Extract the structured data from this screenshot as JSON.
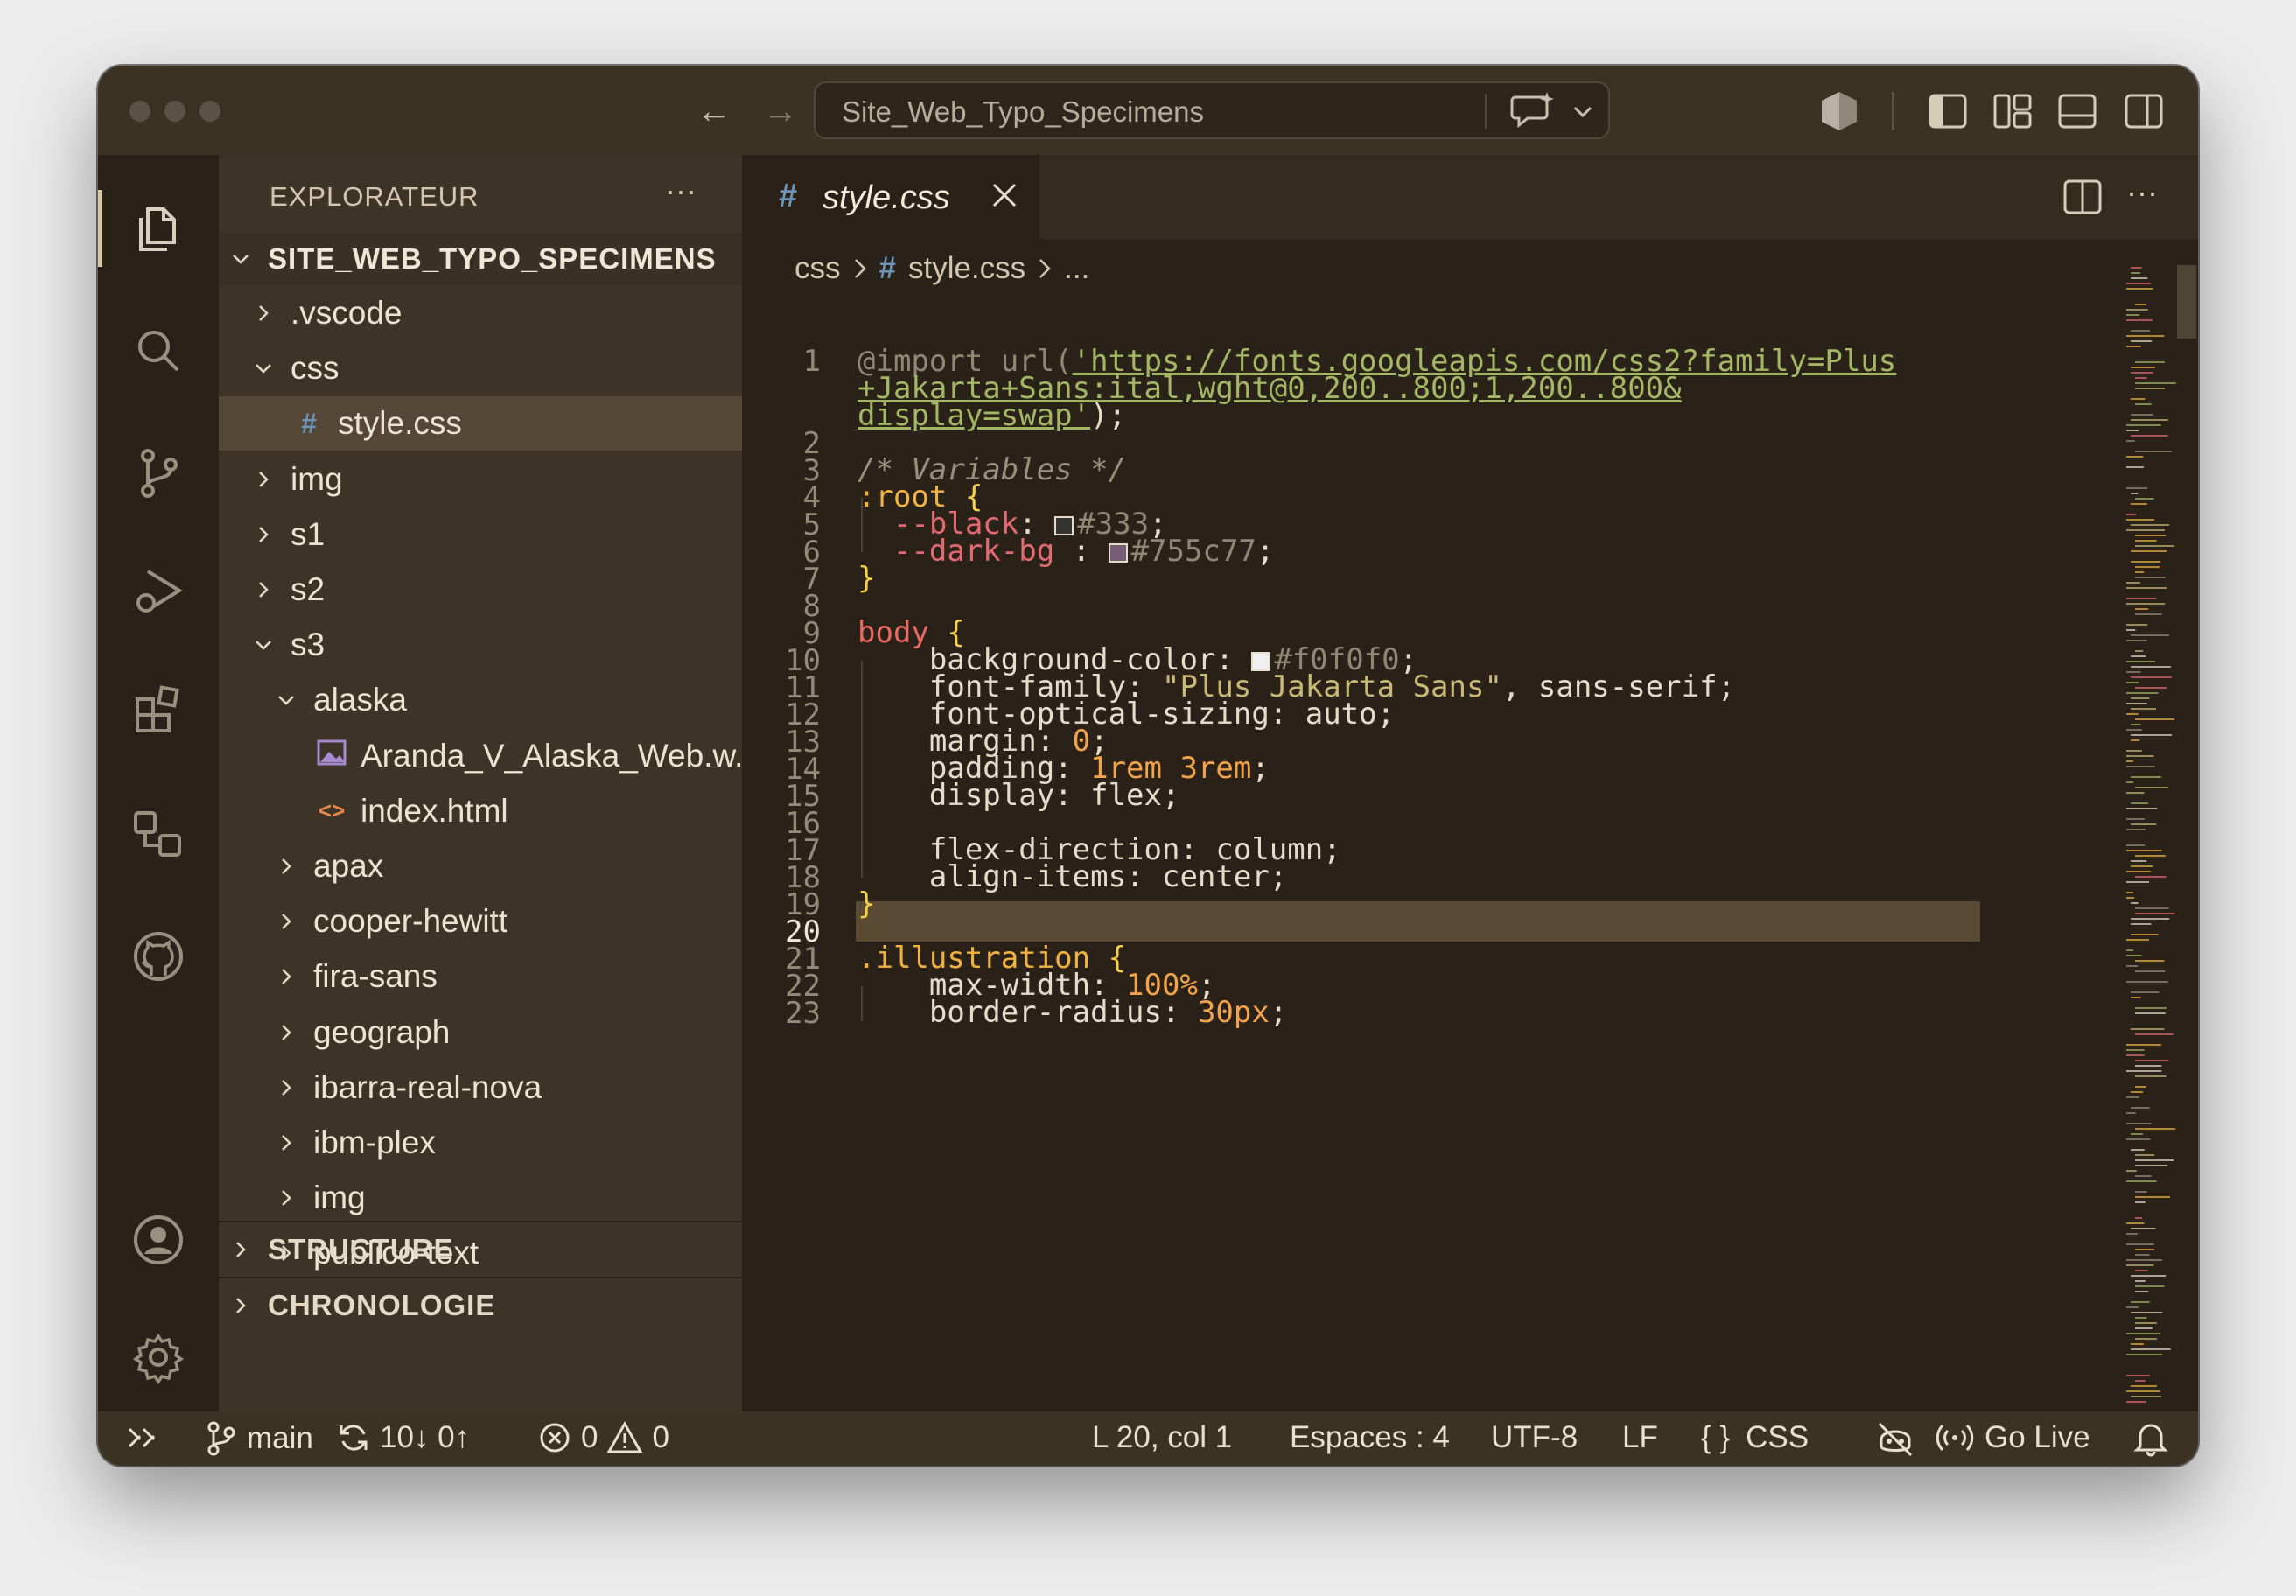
{
  "window": {
    "command_center": "Site_Web_Typo_Specimens"
  },
  "sidebar": {
    "title": "EXPLORATEUR",
    "more": "···",
    "root": "SITE_WEB_TYPO_SPECIMENS",
    "items": [
      {
        "label": ".vscode",
        "type": "folder",
        "expanded": false
      },
      {
        "label": "css",
        "type": "folder",
        "expanded": true
      },
      {
        "label": "style.css",
        "type": "css",
        "selected": true
      },
      {
        "label": "img",
        "type": "folder",
        "expanded": false
      },
      {
        "label": "s1",
        "type": "folder",
        "expanded": false
      },
      {
        "label": "s2",
        "type": "folder",
        "expanded": false
      },
      {
        "label": "s3",
        "type": "folder",
        "expanded": true
      },
      {
        "label": "alaska",
        "type": "folder",
        "expanded": true
      },
      {
        "label": "Aranda_V_Alaska_Web.w...",
        "type": "image"
      },
      {
        "label": "index.html",
        "type": "html"
      },
      {
        "label": "apax",
        "type": "folder",
        "expanded": false
      },
      {
        "label": "cooper-hewitt",
        "type": "folder",
        "expanded": false
      },
      {
        "label": "fira-sans",
        "type": "folder",
        "expanded": false
      },
      {
        "label": "geograph",
        "type": "folder",
        "expanded": false
      },
      {
        "label": "ibarra-real-nova",
        "type": "folder",
        "expanded": false
      },
      {
        "label": "ibm-plex",
        "type": "folder",
        "expanded": false
      },
      {
        "label": "img",
        "type": "folder",
        "expanded": false
      },
      {
        "label": "publico-text",
        "type": "folder",
        "expanded": false
      }
    ],
    "sections": [
      "STRUCTURE",
      "CHRONOLOGIE"
    ]
  },
  "editor": {
    "tab_hash": "#",
    "tab_name": "style.css",
    "breadcrumb": [
      "css",
      "#",
      "style.css",
      "..."
    ],
    "line_numbers": [
      "1",
      "",
      "",
      "2",
      "3",
      "4",
      "5",
      "6",
      "7",
      "8",
      "9",
      "10",
      "11",
      "12",
      "13",
      "14",
      "15",
      "16",
      "17",
      "18",
      "19",
      "20",
      "21",
      "22",
      "23"
    ],
    "current_line": "20",
    "swatch_colors": {
      "black": "#333333",
      "dark_bg": "#755c77",
      "bg": "#f0f0f0"
    }
  },
  "code": {
    "l1_import": "@import",
    "l1_fn": " url(",
    "l1_url_a": "'https://fonts.googleapis.com/css2?family=Plus",
    "l1_url_b": "+Jakarta+Sans:ital,wght@0,200..800;1,200..800&",
    "l1_url_c": "display=swap'",
    "l1_end": ");",
    "l3": "/* Variables */",
    "l4_sel": ":root",
    "l4_brace": " {",
    "l5_prop": "  --black",
    "l5_colon": ": ",
    "l5_val": "#333",
    "l5_end": ";",
    "l6_prop": "  --dark-bg",
    "l6_colon": " : ",
    "l6_val": "#755c77",
    "l6_end": ";",
    "l7": "}",
    "l9_sel": "body",
    "l9_brace": " {",
    "l10_prop": "    background-color: ",
    "l10_val": "#f0f0f0",
    "l10_end": ";",
    "l11_prop": "    font-family: ",
    "l11_str": "\"Plus Jakarta Sans\"",
    "l11_rest": ", sans-serif;",
    "l12": "    font-optical-sizing: auto;",
    "l13_prop": "    margin: ",
    "l13_val": "0",
    "l13_end": ";",
    "l14_prop": "    padding: ",
    "l14_val": "1rem 3rem",
    "l14_end": ";",
    "l15": "    display: flex;",
    "l17": "    flex-direction: column;",
    "l18": "    align-items: center;",
    "l19": "}",
    "l21_sel": ".illustration",
    "l21_brace": " {",
    "l22_prop": "    max-width: ",
    "l22_val": "100%",
    "l22_end": ";",
    "l23_prop": "    border-radius: ",
    "l23_val": "30px",
    "l23_end": ";"
  },
  "statusbar": {
    "branch": "main",
    "sync": "10↓ 0↑",
    "errors": "0",
    "warnings": "0",
    "position": "L 20, col 1",
    "spaces": "Espaces : 4",
    "encoding": "UTF-8",
    "eol": "LF",
    "braces": "{ }",
    "language": "CSS",
    "golive": "Go Live"
  }
}
